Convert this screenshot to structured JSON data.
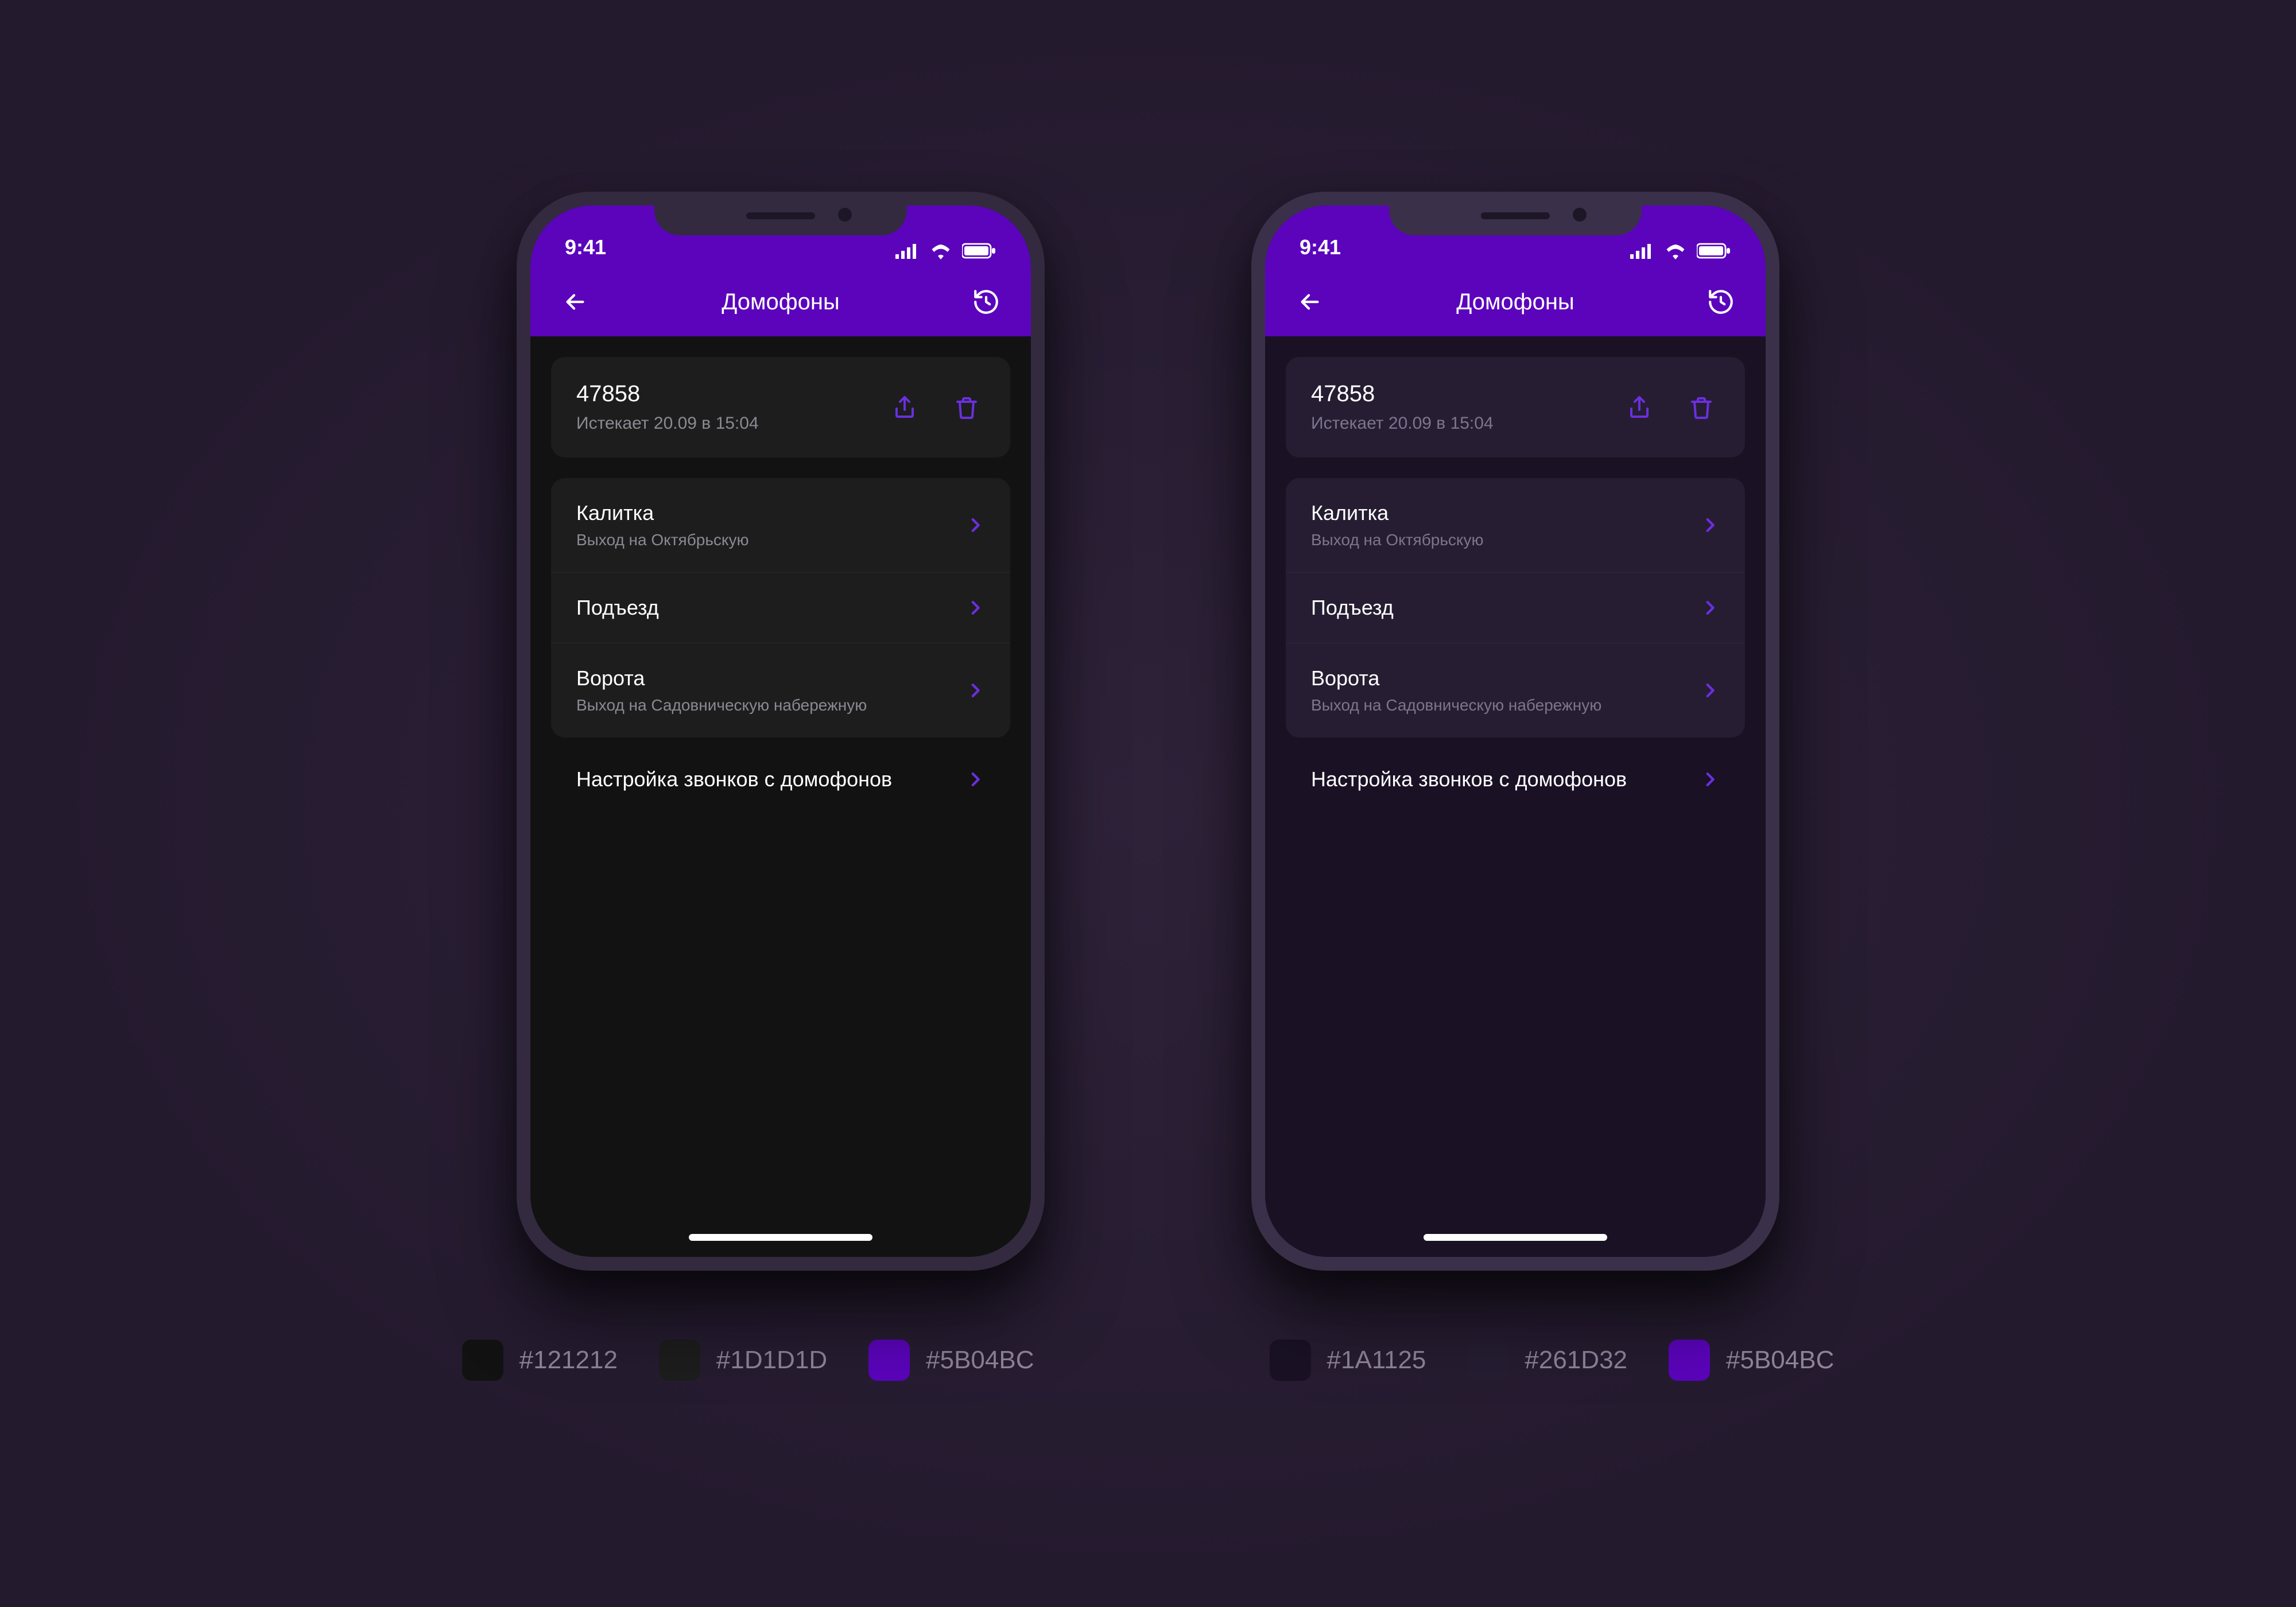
{
  "status": {
    "time": "9:41"
  },
  "header": {
    "title": "Домофоны"
  },
  "code_card": {
    "code": "47858",
    "expires": "Истекает 20.09 в 15:04"
  },
  "doors": [
    {
      "title": "Калитка",
      "subtitle": "Выход на Октябрьскую"
    },
    {
      "title": "Подъезд",
      "subtitle": ""
    },
    {
      "title": "Ворота",
      "subtitle": "Выход на Садовническую набережную"
    }
  ],
  "settings_link": "Настройка звонков с домофонов",
  "palette": {
    "left": [
      {
        "hex": "#121212"
      },
      {
        "hex": "#1D1D1D"
      },
      {
        "hex": "#5B04BC"
      }
    ],
    "right": [
      {
        "hex": "#1A1125"
      },
      {
        "hex": "#261D32"
      },
      {
        "hex": "#5B04BC"
      }
    ]
  },
  "colors": {
    "accent": "#5B04BC"
  }
}
